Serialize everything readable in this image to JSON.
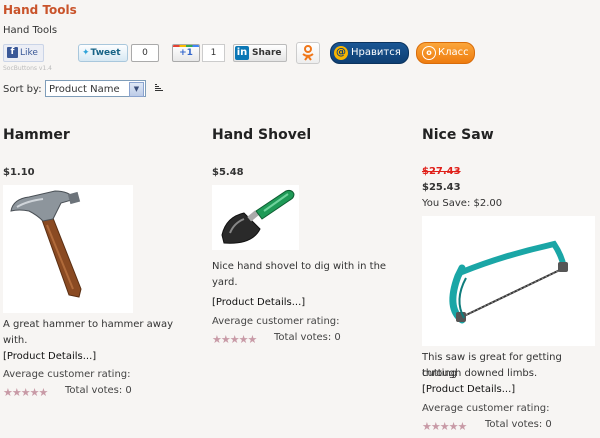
{
  "category": {
    "title": "Hand Tools",
    "subtitle": "Hand Tools"
  },
  "social": {
    "fb_like_label": "Like",
    "tweet_label": "Tweet",
    "tweet_count": "0",
    "gplus_label": "+1",
    "gplus_count": "1",
    "linkedin_label": "Share",
    "mailru_label": "Нравится",
    "ok_label": "Класс",
    "version_text": "SocButtons v1.4"
  },
  "sort": {
    "label": "Sort by:",
    "selected": "Product Name"
  },
  "colors": {
    "category_title": "#c9532a",
    "old_price": "#e0201a",
    "background": "#f7f5f3"
  },
  "products": [
    {
      "name": "Hammer",
      "price": "$1.10",
      "image_icon": "hammer-image",
      "description_line1": "A great hammer to hammer away",
      "description_line2": "with.",
      "details_link": "[Product Details...]",
      "rating_label": "Average customer rating:",
      "stars": "★★★★★",
      "votes": "Total votes: 0"
    },
    {
      "name": "Hand Shovel",
      "price": "$5.48",
      "image_icon": "hand-shovel-image",
      "description_line1": "Nice hand shovel to dig with in the",
      "description_line2": "yard.",
      "details_link": "[Product Details...]",
      "rating_label": "Average customer rating:",
      "stars": "★★★★★",
      "votes": "Total votes: 0"
    },
    {
      "name": "Nice Saw",
      "old_price": "$27.43",
      "price": "$25.43",
      "you_save": "You Save: $2.00",
      "image_icon": "hacksaw-image",
      "description_line1": "This saw is great for getting cutting",
      "description_line2": "through downed limbs.",
      "details_link": "[Product Details...]",
      "rating_label": "Average customer rating:",
      "stars": "★★★★★",
      "votes": "Total votes: 0"
    }
  ]
}
